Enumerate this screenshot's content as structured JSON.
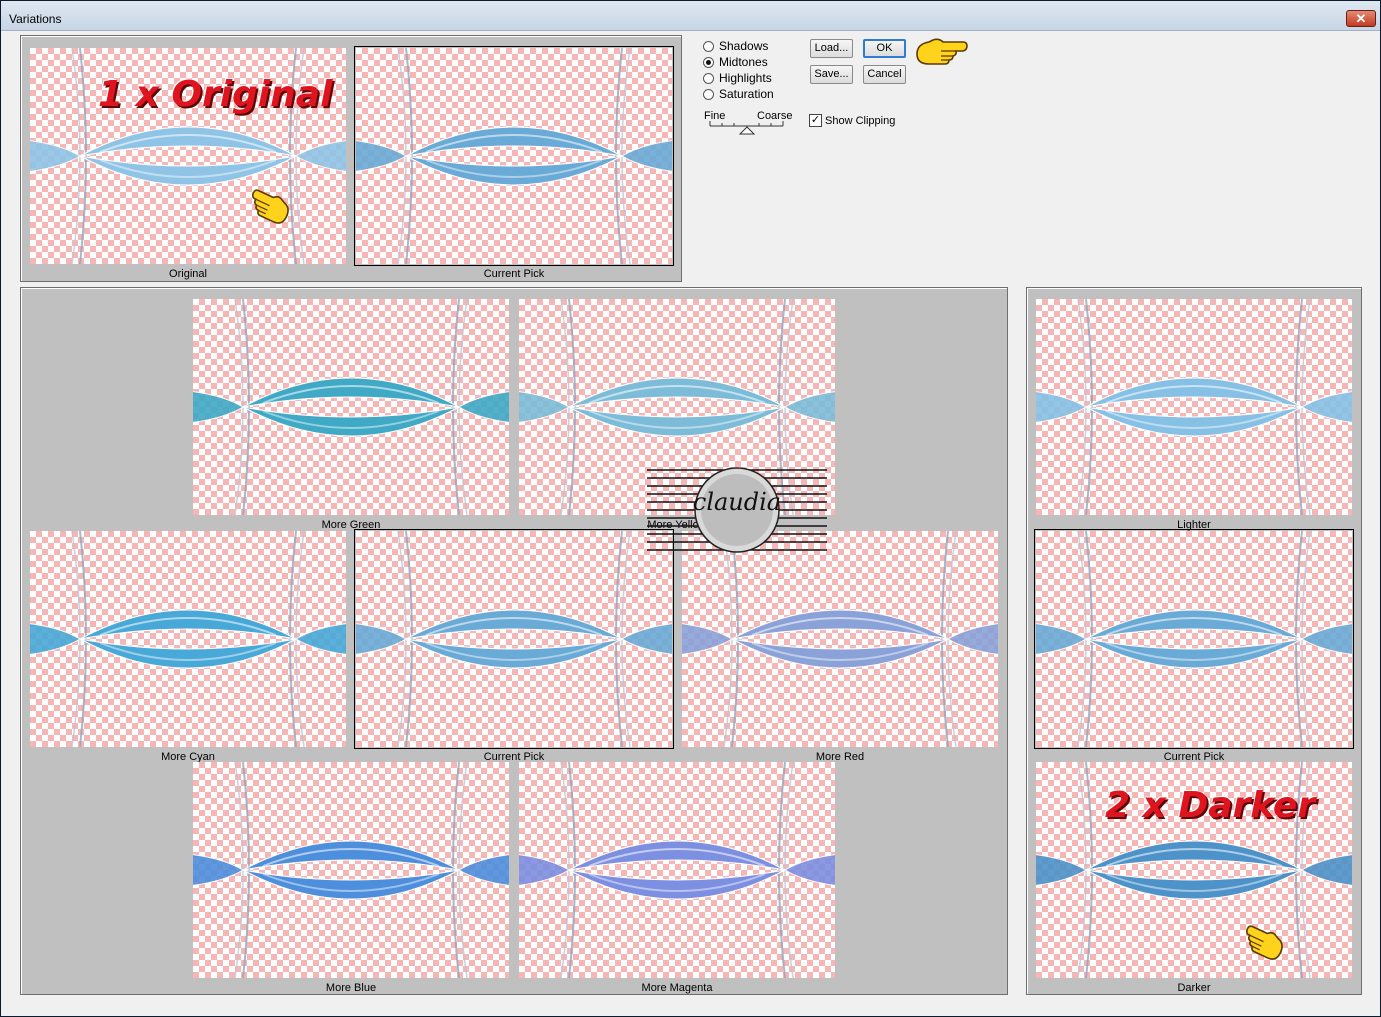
{
  "window": {
    "title": "Variations",
    "close_glyph": "✕"
  },
  "top_previews": [
    {
      "label": "Original",
      "tint": "#8fc4e6",
      "selected": false
    },
    {
      "label": "Current Pick",
      "tint": "#6aaad6",
      "selected": true
    }
  ],
  "tone_options": [
    {
      "label": "Shadows",
      "checked": false
    },
    {
      "label": "Midtones",
      "checked": true
    },
    {
      "label": "Highlights",
      "checked": false
    },
    {
      "label": "Saturation",
      "checked": false
    }
  ],
  "slider": {
    "fine_label": "Fine",
    "coarse_label": "Coarse",
    "position_fraction": 0.5
  },
  "buttons": {
    "load": "Load...",
    "ok": "OK",
    "save": "Save...",
    "cancel": "Cancel"
  },
  "show_clipping": {
    "label": "Show Clipping",
    "checked": true
  },
  "color_variations": [
    {
      "label": "More Green",
      "tint": "#3fa9c6",
      "selected": false
    },
    {
      "label": "More Yellow",
      "tint": "#7cbcd8",
      "selected": false
    },
    {
      "label": "More Cyan",
      "tint": "#48a8d8",
      "selected": false
    },
    {
      "label": "Current Pick",
      "tint": "#6aaad6",
      "selected": true
    },
    {
      "label": "More Red",
      "tint": "#8aa2d8",
      "selected": false
    },
    {
      "label": "More Blue",
      "tint": "#4d8fdc",
      "selected": false
    },
    {
      "label": "More Magenta",
      "tint": "#7d8fe0",
      "selected": false
    }
  ],
  "brightness_variations": [
    {
      "label": "Lighter",
      "tint": "#86c0e4",
      "selected": false
    },
    {
      "label": "Current Pick",
      "tint": "#6aaad6",
      "selected": true
    },
    {
      "label": "Darker",
      "tint": "#4d92c8",
      "selected": false
    }
  ],
  "annotations": {
    "original_note": "1 x Original",
    "darker_note": "2 x Darker",
    "watermark": "claudia"
  },
  "colors": {
    "panel_bg": "#c0c0c0",
    "checker": "#f6b6b6",
    "note_red": "#e0141f",
    "hand_yellow": "#ffd21c",
    "ok_border": "#2e7bd1"
  },
  "icons": {
    "pointer": "pointing-hand-icon",
    "close": "close-icon"
  }
}
